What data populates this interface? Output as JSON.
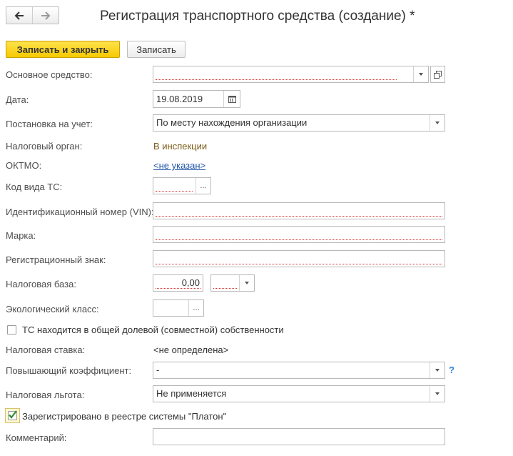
{
  "header": {
    "title": "Регистрация транспортного средства (создание) *",
    "nav_back": "back-arrow",
    "nav_forward": "forward-arrow"
  },
  "toolbar": {
    "save_close_label": "Записать и закрыть",
    "save_label": "Записать"
  },
  "form": {
    "asset_label": "Основное средство:",
    "asset_value": "",
    "date_label": "Дата:",
    "date_value": "19.08.2019",
    "registration_label": "Постановка на учет:",
    "registration_value": "По месту нахождения организации",
    "tax_authority_label": "Налоговый орган:",
    "tax_authority_value": "В инспекции",
    "oktmo_label": "ОКТМО:",
    "oktmo_value": "<не указан>",
    "vehicle_code_label": "Код вида ТС:",
    "vehicle_code_button": "...",
    "vin_label": "Идентификационный номер (VIN):",
    "brand_label": "Марка:",
    "reg_sign_label": "Регистрационный знак:",
    "tax_base_label": "Налоговая база:",
    "tax_base_value": "0,00",
    "eco_class_label": "Экологический класс:",
    "eco_class_button": "...",
    "shared_ownership_label": "ТС находится в общей долевой (совместной) собственности",
    "shared_ownership_checked": false,
    "tax_rate_label": "Налоговая ставка:",
    "tax_rate_value": "<не определена>",
    "multiplier_label": "Повышающий коэффициент:",
    "multiplier_value": "-",
    "multiplier_help": "?",
    "tax_benefit_label": "Налоговая льгота:",
    "tax_benefit_value": "Не применяется",
    "platon_label": "Зарегистрировано в реестре системы \"Платон\"",
    "platon_checked": true,
    "comment_label": "Комментарий:",
    "comment_value": ""
  },
  "colors": {
    "primary_button": "#f6c900",
    "link": "#2256a9",
    "tax_authority_text": "#7a5a16",
    "required_underline": "#d32f2f",
    "checkmark": "#2e8b2e"
  }
}
